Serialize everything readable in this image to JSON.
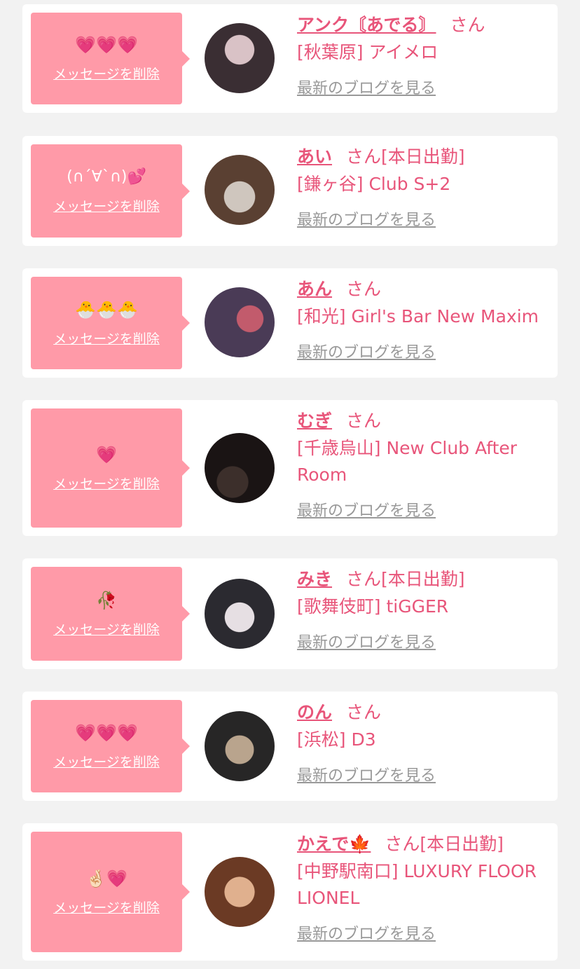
{
  "items": [
    {
      "message": "💗💗💗",
      "delete_label": "メッセージを削除",
      "name": "アンク〘あでる〙",
      "suffix": "さん",
      "status": "",
      "shop": "[秋葉原] アイメロ",
      "blog_label": "最新のブログを見る",
      "avatar_colors": [
        "#3a2e33",
        "#d9c2c6"
      ]
    },
    {
      "message": "(∩´∀`∩)💕",
      "delete_label": "メッセージを削除",
      "name": "あい",
      "suffix": "さん",
      "status": "[本日出勤]",
      "shop": "[鎌ヶ谷] Club S+2",
      "blog_label": "最新のブログを見る",
      "avatar_colors": [
        "#5a4032",
        "#cfc6be"
      ]
    },
    {
      "message": "🐣🐣🐣",
      "delete_label": "メッセージを削除",
      "name": "あん",
      "suffix": "さん",
      "status": "",
      "shop": "[和光] Girl's Bar New Maxim",
      "blog_label": "最新のブログを見る",
      "avatar_colors": [
        "#4a3b56",
        "#c25b6c"
      ]
    },
    {
      "message": "💗",
      "delete_label": "メッセージを削除",
      "name": "むぎ",
      "suffix": "さん",
      "status": "",
      "shop": "[千歳烏山] New Club After Room",
      "blog_label": "最新のブログを見る",
      "avatar_colors": [
        "#1a1414",
        "#3c2f2b"
      ]
    },
    {
      "message": "🥀",
      "delete_label": "メッセージを削除",
      "name": "みき",
      "suffix": "さん",
      "status": "[本日出勤]",
      "shop": "[歌舞伎町] tiGGER",
      "blog_label": "最新のブログを見る",
      "avatar_colors": [
        "#2b2a30",
        "#e6dfe3"
      ]
    },
    {
      "message": "💗💗💗",
      "delete_label": "メッセージを削除",
      "name": "のん",
      "suffix": "さん",
      "status": "",
      "shop": "[浜松] D3",
      "blog_label": "最新のブログを見る",
      "avatar_colors": [
        "#272626",
        "#b9a48d"
      ]
    },
    {
      "message": "🤞🏻💗",
      "delete_label": "メッセージを削除",
      "name": "かえで🍁",
      "suffix": "さん",
      "status": "[本日出勤]",
      "shop": "[中野駅南口] LUXURY FLOOR LIONEL",
      "blog_label": "最新のブログを見る",
      "avatar_colors": [
        "#6b3a24",
        "#e0b08e"
      ]
    }
  ]
}
